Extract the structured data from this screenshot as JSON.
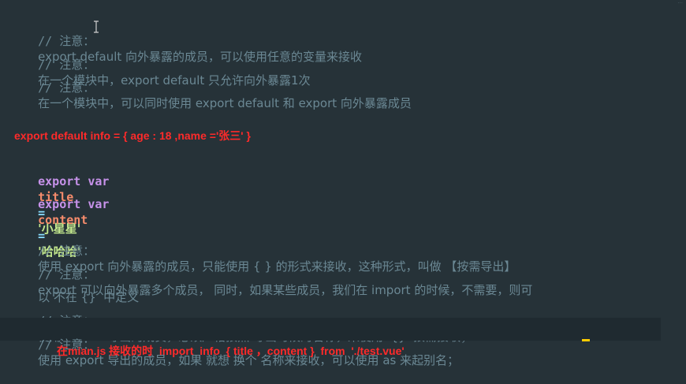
{
  "editor": {
    "corner_label": "···",
    "comments_top": [
      {
        "prefix": "// 注意：",
        "text": "export default 向外暴露的成员，可以使用任意的变量来接收"
      },
      {
        "prefix": "// 注意：",
        "text": "在一个模块中，export default 只允许向外暴露1次"
      },
      {
        "prefix": "// 注意：",
        "text": "在一个模块中，可以同时使用 export default 和 export 向外暴露成员"
      }
    ],
    "note_default": "export default info = { age : 18 ,name ='张三' }",
    "code_lines": [
      {
        "keyword": "export var",
        "name": "title",
        "op": "=",
        "value": "'小星星'"
      },
      {
        "keyword": "export var",
        "name": "content",
        "op": "=",
        "value": "'哈哈哈'"
      }
    ],
    "comments_bottom": [
      {
        "prefix": "// 注意：",
        "text": "使用 export 向外暴露的成员，只能使用 { } 的形式来接收，这种形式，叫做 【按需导出】"
      },
      {
        "prefix": "// 注意：",
        "text": "export 可以向外暴露多个成员， 同时，如果某些成员，我们在 import 的时候，不需要，则可"
      },
      {
        "prefix": "",
        "text": "以 不在 {}  中定义"
      },
      {
        "prefix": "// 注意：",
        "text": "使用 export 导出的成员，必须严格按照 导出时候的名称，来使用  {}  按需接收；"
      },
      {
        "prefix": "// 注意：",
        "text": "使用 export 导出的成员，如果 就想 换个 名称来接收，可以使用 as 来起别名；"
      }
    ],
    "note_import": "在mian.js 接收的时  import  info  { title ，content }  from  './test.vue'"
  }
}
